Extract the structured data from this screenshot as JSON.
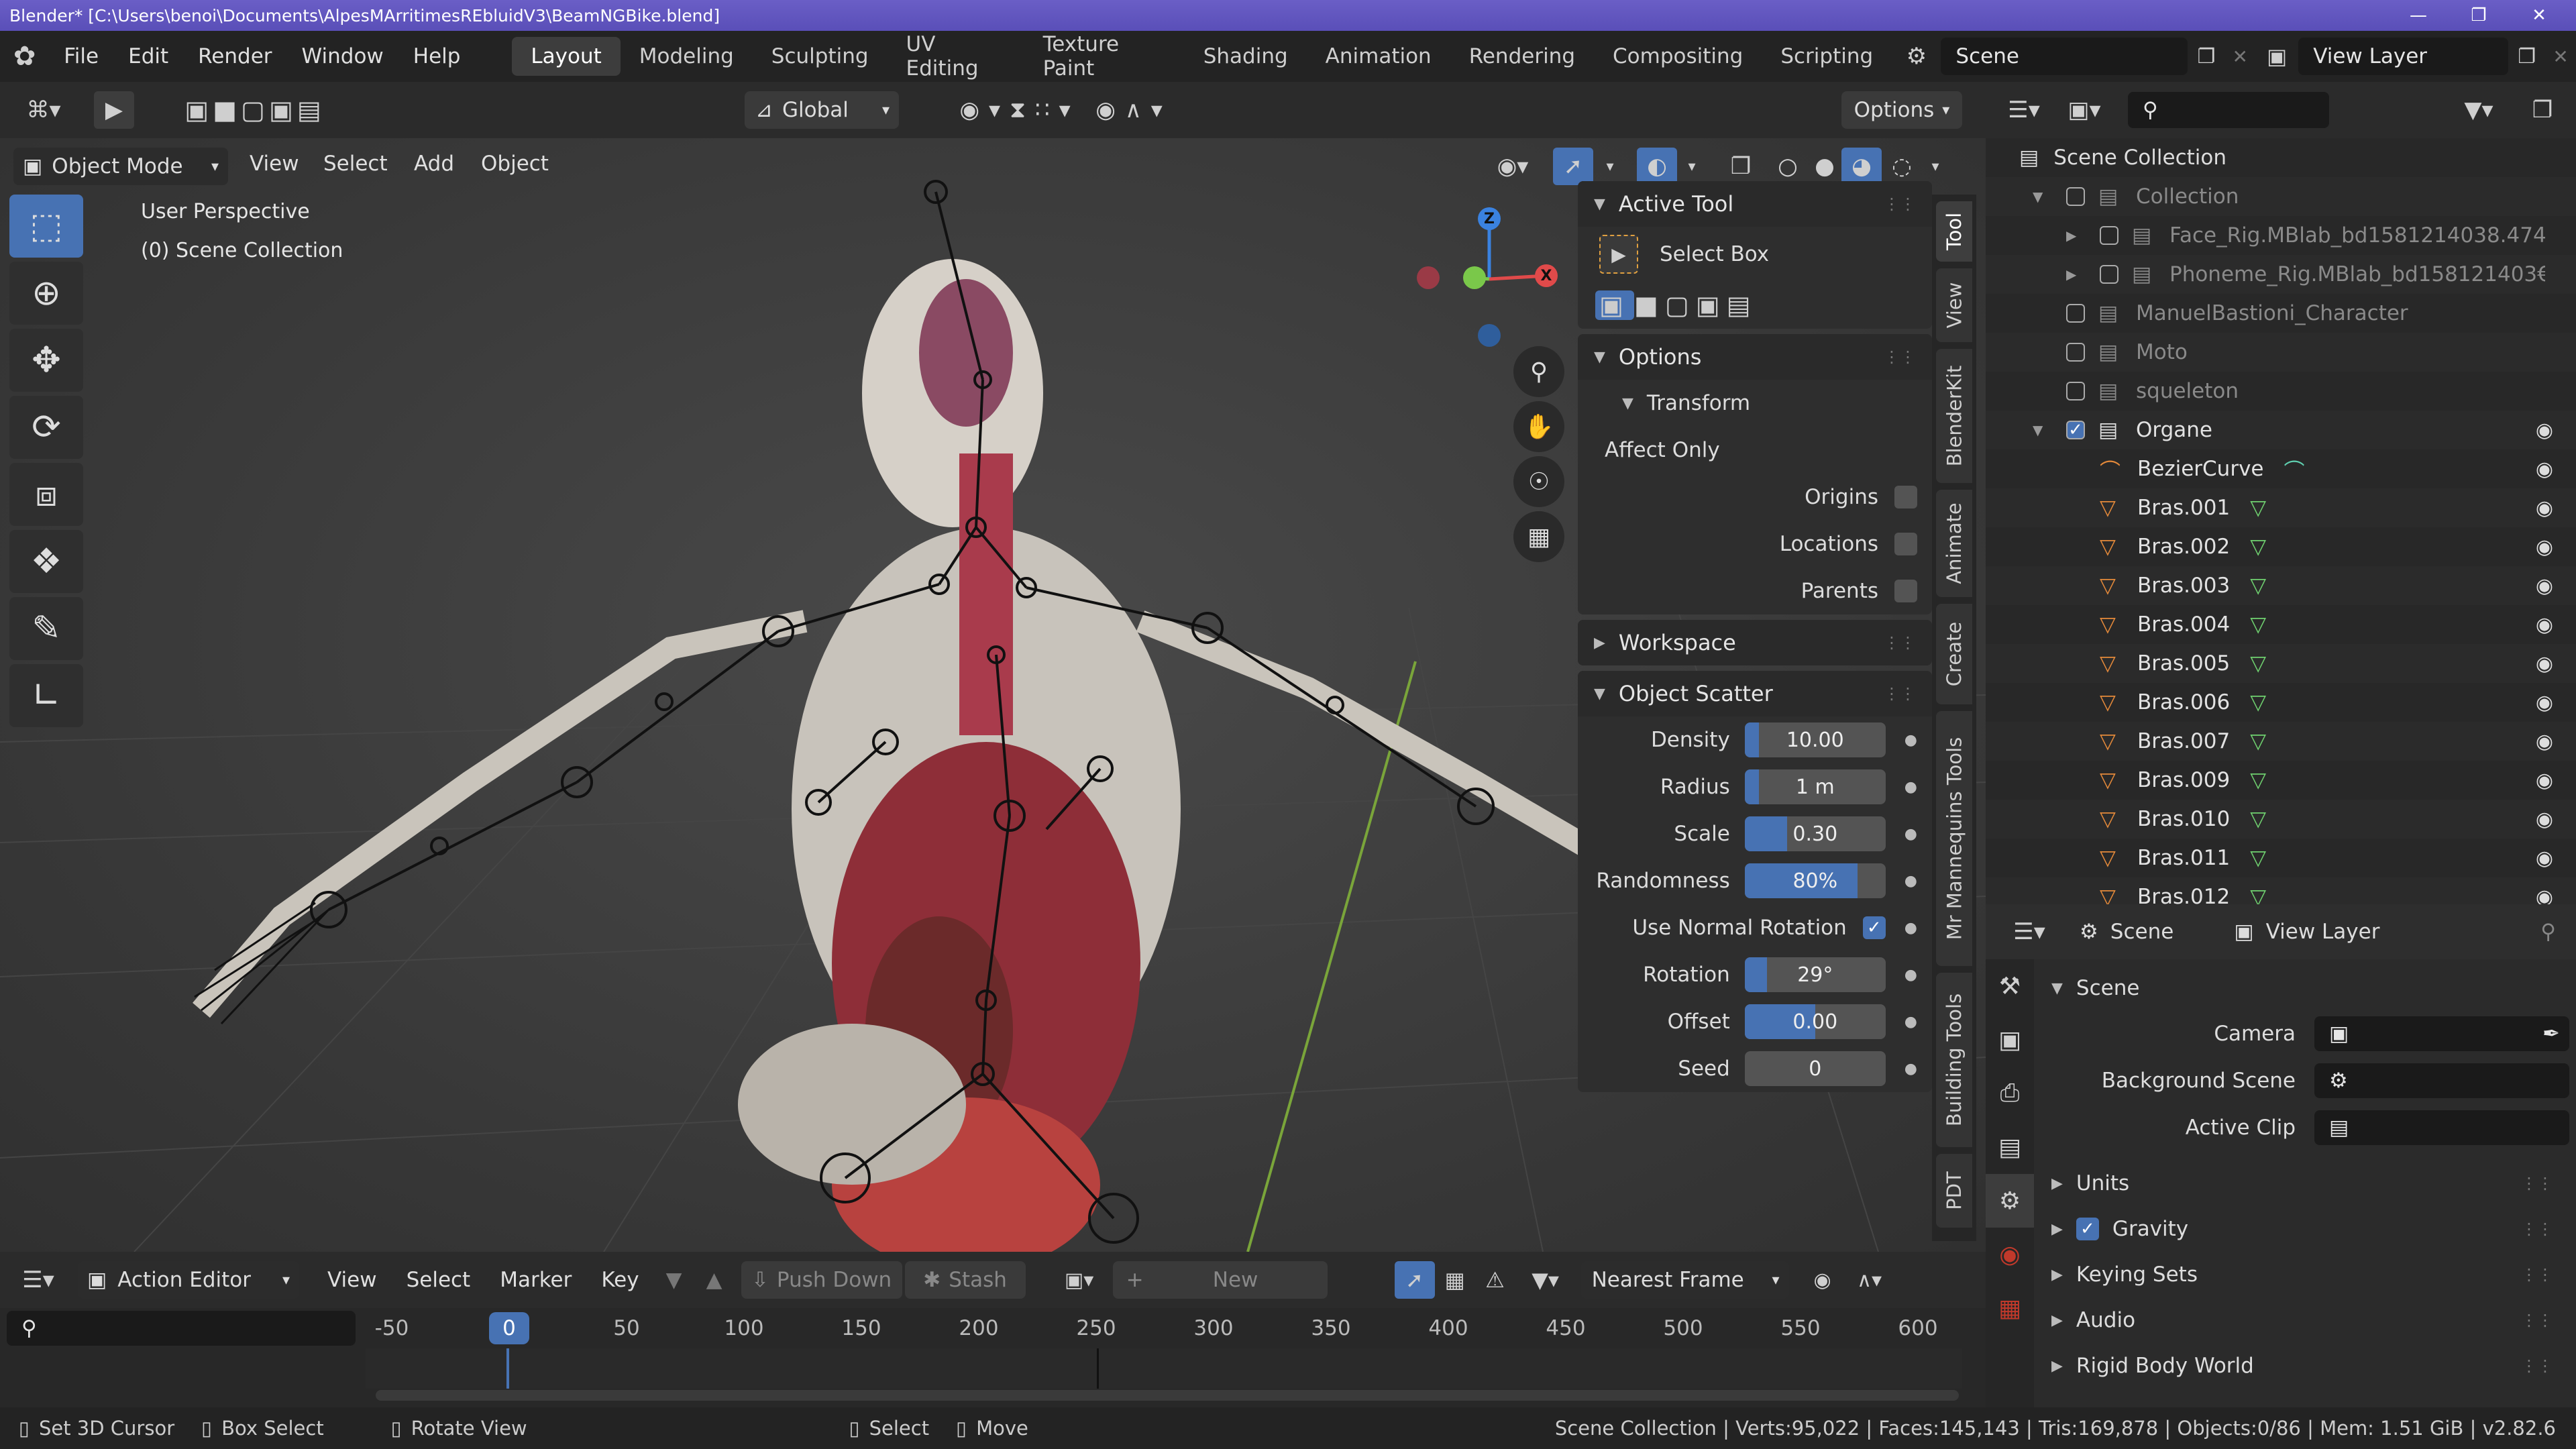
{
  "window": {
    "title": "Blender* [C:\\Users\\benoi\\Documents\\AlpesMArritimesREbluidV3\\BeamNGBike.blend]"
  },
  "menu": [
    "File",
    "Edit",
    "Render",
    "Window",
    "Help"
  ],
  "workspaces": [
    "Layout",
    "Modeling",
    "Sculpting",
    "UV Editing",
    "Texture Paint",
    "Shading",
    "Animation",
    "Rendering",
    "Compositing",
    "Scripting"
  ],
  "active_workspace": "Layout",
  "scene_field": "Scene",
  "view_layer_field": "View Layer",
  "viewport": {
    "header": {
      "mode": "Object Mode",
      "menus": [
        "View",
        "Select",
        "Add",
        "Object"
      ],
      "orientation": "Global",
      "options": "Options"
    },
    "overlay_text": {
      "line1": "User Perspective",
      "line2": "(0) Scene Collection"
    },
    "gizmo": {
      "z": "Z",
      "x": "X"
    }
  },
  "npanel": {
    "active_tool": {
      "title": "Active Tool",
      "tool": "Select Box"
    },
    "options": {
      "title": "Options",
      "transform": "Transform",
      "affect_only": "Affect Only",
      "origins": "Origins",
      "locations": "Locations",
      "parents": "Parents"
    },
    "workspace": "Workspace",
    "object_scatter": {
      "title": "Object Scatter",
      "rows": [
        {
          "label": "Density",
          "value": "10.00",
          "fill": 0.1
        },
        {
          "label": "Radius",
          "value": "1 m",
          "fill": 0.1
        },
        {
          "label": "Scale",
          "value": "0.30",
          "fill": 0.3
        },
        {
          "label": "Randomness",
          "value": "80%",
          "fill": 0.8
        }
      ],
      "use_normal_rotation": "Use Normal Rotation",
      "rows2": [
        {
          "label": "Rotation",
          "value": "29°",
          "fill": 0.16
        },
        {
          "label": "Offset",
          "value": "0.00",
          "fill": 0.5
        },
        {
          "label": "Seed",
          "value": "0",
          "fill": 0
        }
      ]
    }
  },
  "sidetabs": [
    "Tool",
    "View",
    "BlenderKit",
    "Animate",
    "Create",
    "Mr Mannequins Tools",
    "Building Tools",
    "PDT"
  ],
  "outliner": {
    "root": "Scene Collection",
    "items": [
      {
        "name": "Collection",
        "indent": 1,
        "type": "coll",
        "dim": true
      },
      {
        "name": "Face_Rig.MBlab_bd1581214038.474",
        "indent": 2,
        "type": "coll",
        "dim": true
      },
      {
        "name": "Phoneme_Rig.MBlab_bd158121403€",
        "indent": 2,
        "type": "coll",
        "dim": true
      },
      {
        "name": "ManuelBastioni_Character",
        "indent": 1,
        "type": "coll",
        "dim": true
      },
      {
        "name": "Moto",
        "indent": 1,
        "type": "coll",
        "dim": true
      },
      {
        "name": "squeleton",
        "indent": 1,
        "type": "coll",
        "dim": true
      },
      {
        "name": "Organe",
        "indent": 1,
        "type": "coll",
        "dim": false
      },
      {
        "name": "BezierCurve",
        "indent": 2,
        "type": "curve",
        "dim": false
      },
      {
        "name": "Bras.001",
        "indent": 2,
        "type": "mesh",
        "dim": false
      },
      {
        "name": "Bras.002",
        "indent": 2,
        "type": "mesh",
        "dim": false
      },
      {
        "name": "Bras.003",
        "indent": 2,
        "type": "mesh",
        "dim": false
      },
      {
        "name": "Bras.004",
        "indent": 2,
        "type": "mesh",
        "dim": false
      },
      {
        "name": "Bras.005",
        "indent": 2,
        "type": "mesh",
        "dim": false
      },
      {
        "name": "Bras.006",
        "indent": 2,
        "type": "mesh",
        "dim": false
      },
      {
        "name": "Bras.007",
        "indent": 2,
        "type": "mesh",
        "dim": false
      },
      {
        "name": "Bras.009",
        "indent": 2,
        "type": "mesh",
        "dim": false
      },
      {
        "name": "Bras.010",
        "indent": 2,
        "type": "mesh",
        "dim": false
      },
      {
        "name": "Bras.011",
        "indent": 2,
        "type": "mesh",
        "dim": false
      },
      {
        "name": "Bras.012",
        "indent": 2,
        "type": "mesh",
        "dim": false
      }
    ]
  },
  "properties": {
    "breadcrumb_scene": "Scene",
    "breadcrumb_viewlayer": "View Layer",
    "section": "Scene",
    "camera": "Camera",
    "background_scene": "Background Scene",
    "active_clip": "Active Clip",
    "subsections": [
      "Units",
      "Gravity",
      "Keying Sets",
      "Audio",
      "Rigid Body World"
    ]
  },
  "timeline": {
    "editor": "Action Editor",
    "menus": [
      "View",
      "Select",
      "Marker",
      "Key"
    ],
    "push_down": "Push Down",
    "stash": "Stash",
    "new": "New",
    "snap": "Nearest Frame",
    "current_frame": "0",
    "ticks": [
      "-50",
      "50",
      "100",
      "150",
      "200",
      "250",
      "300",
      "350",
      "400",
      "450",
      "500",
      "550",
      "600"
    ]
  },
  "status": {
    "hints": [
      "Set 3D Cursor",
      "Box Select",
      "Rotate View",
      "Select",
      "Move"
    ],
    "info": "Scene Collection | Verts:95,022 | Faces:145,143 | Tris:169,878 | Objects:0/86 | Mem: 1.51 GiB | v2.82.6"
  },
  "colors": {
    "accent": "#4772b3",
    "title_bar": "#5a4fb8",
    "mesh_icon": "#e3893a",
    "vertex_icon": "#6fd06f"
  }
}
